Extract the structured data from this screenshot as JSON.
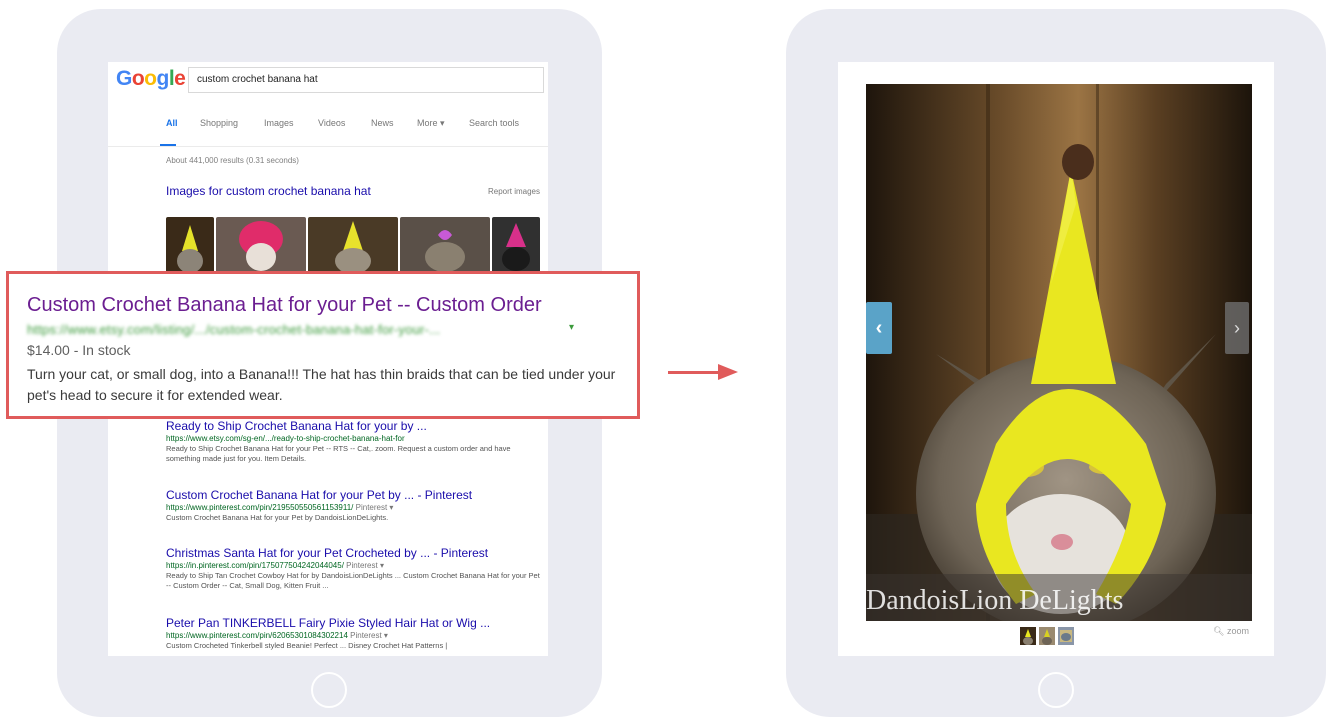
{
  "google": {
    "logo": "Google",
    "query": "custom crochet banana hat",
    "tabs": [
      "All",
      "Shopping",
      "Images",
      "Videos",
      "News",
      "More ▾",
      "Search tools"
    ],
    "stats": "About 441,000 results (0.31 seconds)",
    "images_heading": "Images for custom crochet banana hat",
    "report_images": "Report images"
  },
  "callout": {
    "title": "Custom Crochet Banana Hat for your Pet -- Custom Order",
    "url": "https://www.etsy.com/listing/.../custom-crochet-banana-hat-for-your-...",
    "price": "$14.00 - In stock",
    "snippet": "Turn your cat, or small dog, into a Banana!!! The hat has thin braids that can be tied under your pet's head to secure it for extended wear."
  },
  "results": [
    {
      "title": "Ready to Ship Crochet Banana Hat for your by ...",
      "url": "https://www.etsy.com/sg-en/.../ready-to-ship-crochet-banana-hat-for",
      "snippet": "Ready to Ship Crochet Banana Hat for your Pet -- RTS -- Cat,. zoom. Request a custom order and have something made just for you. Item Details."
    },
    {
      "title": "Custom Crochet Banana Hat for your Pet by ... - Pinterest",
      "url": "https://www.pinterest.com/pin/219550550561153911/",
      "via": "Pinterest ▾",
      "snippet": "Custom Crochet Banana Hat for your Pet by DandoisLionDeLights."
    },
    {
      "title": "Christmas Santa Hat for your Pet Crocheted by ... - Pinterest",
      "url": "https://in.pinterest.com/pin/175077504242044045/",
      "via": "Pinterest ▾",
      "snippet": "Ready to Ship Tan Crochet Cowboy Hat for by DandoisLionDeLights ... Custom Crochet Banana Hat for your Pet -- Custom Order -- Cat, Small Dog, Kitten Fruit ..."
    },
    {
      "title": "Peter Pan TINKERBELL Fairy Pixie Styled Hair Hat or Wig ...",
      "url": "https://www.pinterest.com/pin/62065301084302214",
      "via": "Pinterest ▾",
      "snippet": "Custom Crocheted Tinkerbell styled Beanie! Perfect ... Disney Crochet Hat Patterns |"
    }
  ],
  "product": {
    "watermark": "DandoisLion DeLights",
    "zoom_label": "zoom",
    "prev_icon": "‹",
    "next_icon": "›"
  },
  "colors": {
    "highlight": "#e05b5b",
    "link": "#1a0dab",
    "callout_title": "#6b1e91",
    "url_green": "#006621",
    "nav_prev": "#5aa3c8"
  }
}
